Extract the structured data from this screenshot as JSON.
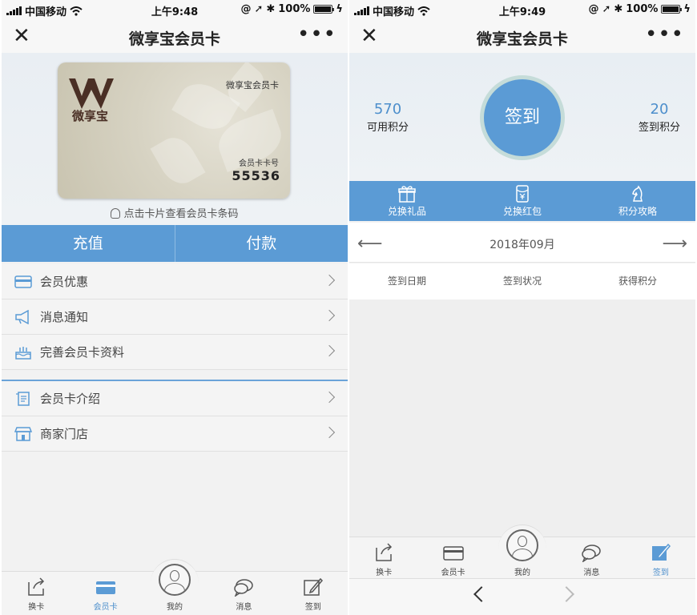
{
  "status_bar": {
    "carrier": "中国移动",
    "battery": "100%",
    "left_time": "上午9:48",
    "right_time": "上午9:49"
  },
  "nav": {
    "title": "微享宝会员卡",
    "close_glyph": "✕",
    "more_glyph": "•••"
  },
  "card_screen": {
    "card": {
      "brand_text": "微享宝",
      "title": "微享宝会员卡",
      "number_label": "会员卡卡号",
      "number": "55536",
      "brand_color": "#4a2f25"
    },
    "barcode_hint": "点击卡片查看会员卡条码",
    "actions": {
      "recharge": "充值",
      "pay": "付款"
    },
    "menu_group1": [
      {
        "label": "会员优惠",
        "icon": "card-icon"
      },
      {
        "label": "消息通知",
        "icon": "megaphone-icon"
      },
      {
        "label": "完善会员卡资料",
        "icon": "cake-icon"
      }
    ],
    "menu_group2": [
      {
        "label": "会员卡介绍",
        "icon": "scroll-icon"
      },
      {
        "label": "商家门店",
        "icon": "store-icon"
      }
    ]
  },
  "tabs": [
    {
      "label": "换卡",
      "icon": "share-icon"
    },
    {
      "label": "会员卡",
      "icon": "card-icon"
    },
    {
      "label": "我的",
      "icon": "avatar-icon"
    },
    {
      "label": "消息",
      "icon": "chat-icon"
    },
    {
      "label": "签到",
      "icon": "edit-icon"
    }
  ],
  "checkin_screen": {
    "available_points": {
      "value": "570",
      "label": "可用积分"
    },
    "checkin_points": {
      "value": "20",
      "label": "签到积分"
    },
    "checkin_button": "签到",
    "features": [
      {
        "label": "兑换礼品",
        "icon": "gift-icon"
      },
      {
        "label": "兑换红包",
        "icon": "red-packet-icon"
      },
      {
        "label": "积分攻略",
        "icon": "chess-knight-icon"
      }
    ],
    "month": "2018年09月",
    "columns": [
      "签到日期",
      "签到状况",
      "获得积分"
    ]
  },
  "colors": {
    "accent": "#5b9bd5",
    "accent_text": "#4d8fcc"
  }
}
